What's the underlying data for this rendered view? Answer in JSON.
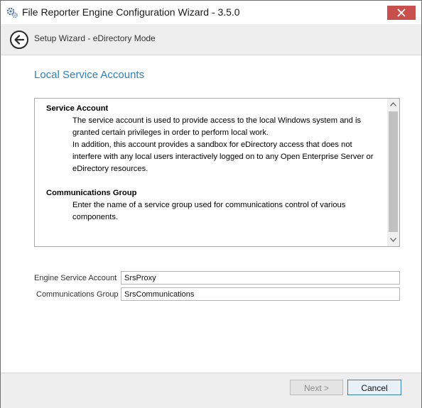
{
  "window": {
    "title": "File Reporter Engine Configuration Wizard - 3.5.0"
  },
  "header": {
    "subtitle": "Setup Wizard - eDirectory Mode"
  },
  "page": {
    "title": "Local Service Accounts"
  },
  "description": {
    "sections": [
      {
        "heading": "Service Account",
        "paragraphs": [
          "The service account is used to provide access to the local Windows system and is granted certain privileges in order to perform local work.",
          "In addition, this account provides a sandbox for eDirectory access that does not interfere with any local users interactively logged on to any Open Enterprise Server or eDirectory resources."
        ]
      },
      {
        "heading": "Communications Group",
        "paragraphs": [
          "Enter the name of a service group used for communications control of various components."
        ]
      }
    ]
  },
  "form": {
    "engine_service_account": {
      "label": "Engine Service Account",
      "value": "SrsProxy"
    },
    "communications_group": {
      "label": "Communications Group",
      "value": "SrsCommunications"
    }
  },
  "footer": {
    "next_label": "Next >",
    "cancel_label": "Cancel"
  },
  "colors": {
    "accent_title": "#2f7fb8",
    "close_button": "#c7504c",
    "cancel_border": "#3c7fb1"
  },
  "icons": {
    "app": "gears-icon",
    "close": "close-icon",
    "back": "back-arrow-icon",
    "scroll_up": "chevron-up-icon",
    "scroll_down": "chevron-down-icon"
  }
}
